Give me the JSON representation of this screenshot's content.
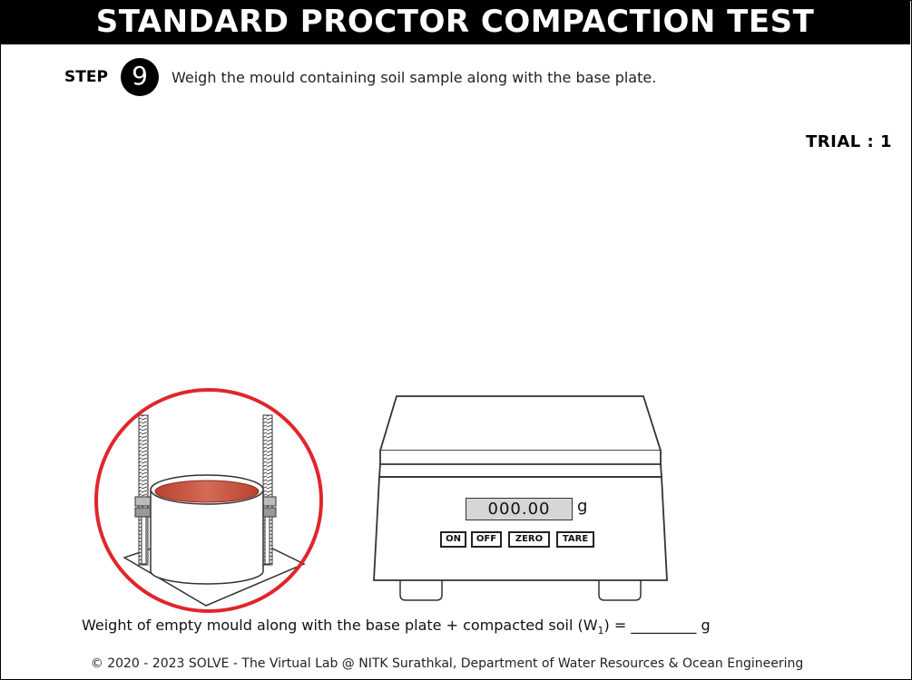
{
  "title": "STANDARD PROCTOR COMPACTION TEST",
  "step": {
    "label": "STEP",
    "number": "9",
    "instruction": "Weigh the mould containing soil sample along with the base plate."
  },
  "trial": {
    "label": "TRIAL : 1"
  },
  "scale": {
    "display_value": "000.00",
    "unit": "g",
    "buttons": {
      "on": "ON",
      "off": "OFF",
      "zero": "ZERO",
      "tare": "TARE"
    }
  },
  "formula": {
    "text_before": "Weight of empty mould along with the base plate + compacted soil (W",
    "subscript": "1",
    "text_after": ") = _________ g"
  },
  "footer": "© 2020 - 2023 SOLVE - The Virtual Lab @ NITK Surathkal, Department of Water Resources & Ocean Engineering",
  "colors": {
    "highlight_ring": "#e0262b",
    "soil": "#c9543f",
    "header_bg": "#000000"
  },
  "icons": {
    "mould": "proctor-mould-with-base-plate",
    "scale": "digital-weighing-scale"
  }
}
